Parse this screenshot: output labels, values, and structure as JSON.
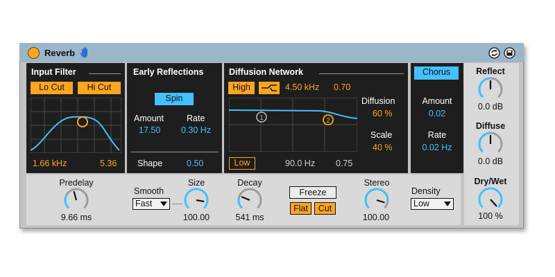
{
  "title": "Reverb",
  "input_filter": {
    "heading": "Input Filter",
    "lo_cut": "Lo Cut",
    "hi_cut": "Hi Cut",
    "freq": "1.66 kHz",
    "width": "5.36"
  },
  "early_reflections": {
    "heading": "Early Reflections",
    "spin": "Spin",
    "amount_label": "Amount",
    "amount_value": "17.50",
    "rate_label": "Rate",
    "rate_value": "0.30 Hz",
    "shape_label": "Shape",
    "shape_value": "0.50"
  },
  "diffusion": {
    "heading": "Diffusion Network",
    "high": "High",
    "high_freq": "4.50 kHz",
    "high_value": "0.70",
    "diffusion_label": "Diffusion",
    "diffusion_value": "60 %",
    "scale_label": "Scale",
    "scale_value": "40 %",
    "low": "Low",
    "low_freq": "90.0 Hz",
    "low_value": "0.75",
    "node1": "1",
    "node2": "2"
  },
  "chorus": {
    "heading": "Chorus",
    "amount_label": "Amount",
    "amount_value": "0.02",
    "rate_label": "Rate",
    "rate_value": "0.02 Hz"
  },
  "bottom": {
    "predelay_label": "Predelay",
    "predelay_value": "9.66 ms",
    "smooth_label": "Smooth",
    "smooth_value": "Fast",
    "size_label": "Size",
    "size_value": "100.00",
    "decay_label": "Decay",
    "decay_value": "541 ms",
    "freeze": "Freeze",
    "flat": "Flat",
    "cut": "Cut",
    "stereo_label": "Stereo",
    "stereo_value": "100.00",
    "density_label": "Density",
    "density_value": "Low"
  },
  "right": {
    "reflect_label": "Reflect",
    "reflect_value": "0.0 dB",
    "diffuse_label": "Diffuse",
    "diffuse_value": "0.0 dB",
    "drywet_label": "Dry/Wet",
    "drywet_value": "100 %"
  },
  "colors": {
    "accent_orange": "#ffa51e",
    "accent_blue": "#44c0ff",
    "panel_dark": "#1e1e1e",
    "title_bar": "#9bb6c9"
  }
}
